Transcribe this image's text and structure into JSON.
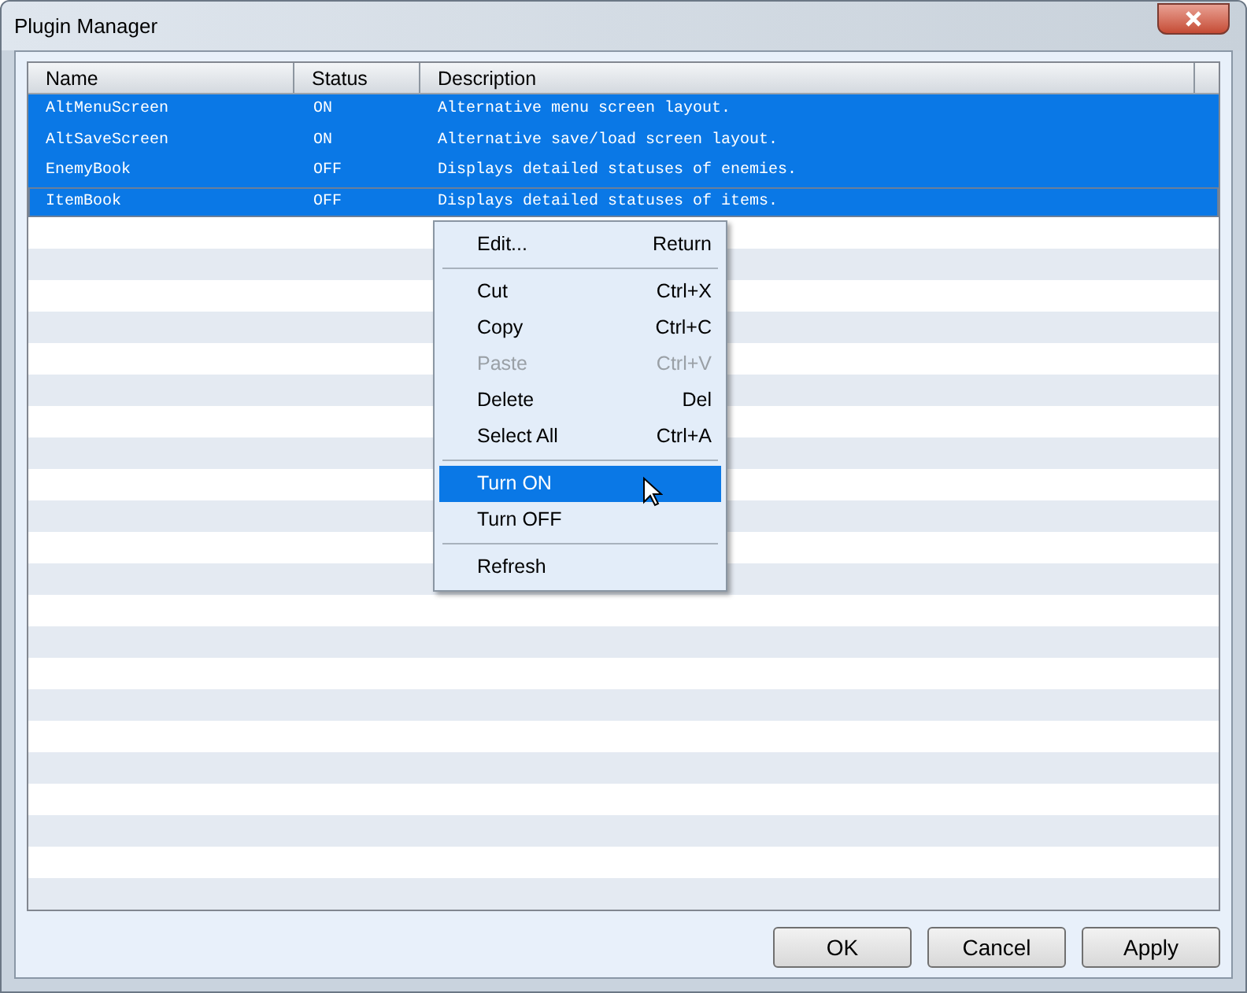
{
  "window": {
    "title": "Plugin Manager"
  },
  "table": {
    "columns": [
      "Name",
      "Status",
      "Description"
    ],
    "rows": [
      {
        "name": "AltMenuScreen",
        "status": "ON",
        "description": "Alternative menu screen layout.",
        "selected": true
      },
      {
        "name": "AltSaveScreen",
        "status": "ON",
        "description": "Alternative save/load screen layout.",
        "selected": true
      },
      {
        "name": "EnemyBook",
        "status": "OFF",
        "description": "Displays detailed statuses of enemies.",
        "selected": true
      },
      {
        "name": "ItemBook",
        "status": "OFF",
        "description": "Displays detailed statuses of items.",
        "selected": true
      }
    ]
  },
  "context_menu": {
    "items": [
      {
        "kind": "item",
        "label": "Edit...",
        "shortcut": "Return",
        "disabled": false,
        "selected": false
      },
      {
        "kind": "separator"
      },
      {
        "kind": "item",
        "label": "Cut",
        "shortcut": "Ctrl+X",
        "disabled": false,
        "selected": false
      },
      {
        "kind": "item",
        "label": "Copy",
        "shortcut": "Ctrl+C",
        "disabled": false,
        "selected": false
      },
      {
        "kind": "item",
        "label": "Paste",
        "shortcut": "Ctrl+V",
        "disabled": true,
        "selected": false
      },
      {
        "kind": "item",
        "label": "Delete",
        "shortcut": "Del",
        "disabled": false,
        "selected": false
      },
      {
        "kind": "item",
        "label": "Select All",
        "shortcut": "Ctrl+A",
        "disabled": false,
        "selected": false
      },
      {
        "kind": "separator"
      },
      {
        "kind": "item",
        "label": "Turn ON",
        "disabled": false,
        "selected": true
      },
      {
        "kind": "item",
        "label": "Turn OFF",
        "disabled": false,
        "selected": false
      },
      {
        "kind": "separator"
      },
      {
        "kind": "item",
        "label": "Refresh",
        "disabled": false,
        "selected": false
      }
    ]
  },
  "buttons": [
    "OK",
    "Cancel",
    "Apply"
  ]
}
